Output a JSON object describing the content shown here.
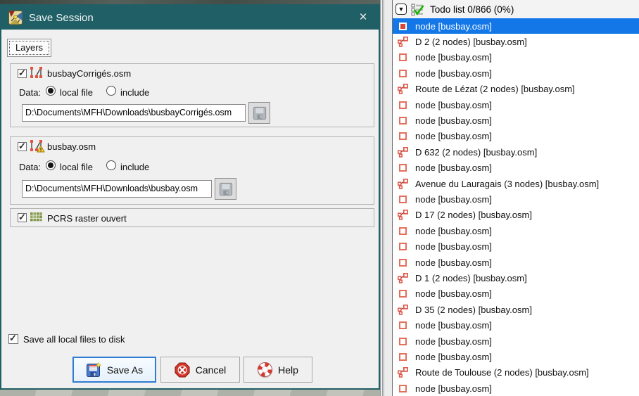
{
  "window": {
    "title": "Save Session",
    "close_glyph": "×"
  },
  "tab": {
    "label": "Layers"
  },
  "layers": [
    {
      "label": "busbayCorrigés.osm",
      "data_label": "Data:",
      "local_file_label": "local file",
      "include_label": "include",
      "path": "D:\\Documents\\MFH\\Downloads\\busbayCorrigés.osm"
    },
    {
      "label": "busbay.osm",
      "data_label": "Data:",
      "local_file_label": "local file",
      "include_label": "include",
      "path": "D:\\Documents\\MFH\\Downloads\\busbay.osm"
    },
    {
      "label": "PCRS raster ouvert"
    }
  ],
  "footer": {
    "save_all_label": "Save all local files to disk",
    "save_as_label": "Save As",
    "cancel_label": "Cancel",
    "help_label": "Help"
  },
  "todo_panel": {
    "title": "Todo list 0/866 (0%)",
    "collapse_glyph": "▼",
    "items": [
      {
        "type": "node",
        "label": "node [busbay.osm]",
        "selected": true
      },
      {
        "type": "way",
        "label": "D 2 (2 nodes) [busbay.osm]"
      },
      {
        "type": "node",
        "label": "node [busbay.osm]"
      },
      {
        "type": "node",
        "label": "node [busbay.osm]"
      },
      {
        "type": "way",
        "label": "Route de Lézat (2 nodes) [busbay.osm]"
      },
      {
        "type": "node",
        "label": "node [busbay.osm]"
      },
      {
        "type": "node",
        "label": "node [busbay.osm]"
      },
      {
        "type": "node",
        "label": "node [busbay.osm]"
      },
      {
        "type": "way",
        "label": "D 632 (2 nodes) [busbay.osm]"
      },
      {
        "type": "node",
        "label": "node [busbay.osm]"
      },
      {
        "type": "way",
        "label": "Avenue du Lauragais (3 nodes) [busbay.osm]"
      },
      {
        "type": "node",
        "label": "node [busbay.osm]"
      },
      {
        "type": "way",
        "label": "D 17 (2 nodes) [busbay.osm]"
      },
      {
        "type": "node",
        "label": "node [busbay.osm]"
      },
      {
        "type": "node",
        "label": "node [busbay.osm]"
      },
      {
        "type": "node",
        "label": "node [busbay.osm]"
      },
      {
        "type": "way",
        "label": "D 1 (2 nodes) [busbay.osm]"
      },
      {
        "type": "node",
        "label": "node [busbay.osm]"
      },
      {
        "type": "way",
        "label": "D 35 (2 nodes) [busbay.osm]"
      },
      {
        "type": "node",
        "label": "node [busbay.osm]"
      },
      {
        "type": "node",
        "label": "node [busbay.osm]"
      },
      {
        "type": "node",
        "label": "node [busbay.osm]"
      },
      {
        "type": "way",
        "label": "Route de Toulouse (2 nodes) [busbay.osm]"
      },
      {
        "type": "node",
        "label": "node [busbay.osm]"
      }
    ]
  },
  "colors": {
    "titlebar": "#215f66",
    "selection_blue": "#1377e8",
    "node_coral": "#e4705c",
    "grid_green": "#7c9348",
    "save_as_focus_border": "#2e7bd2"
  }
}
